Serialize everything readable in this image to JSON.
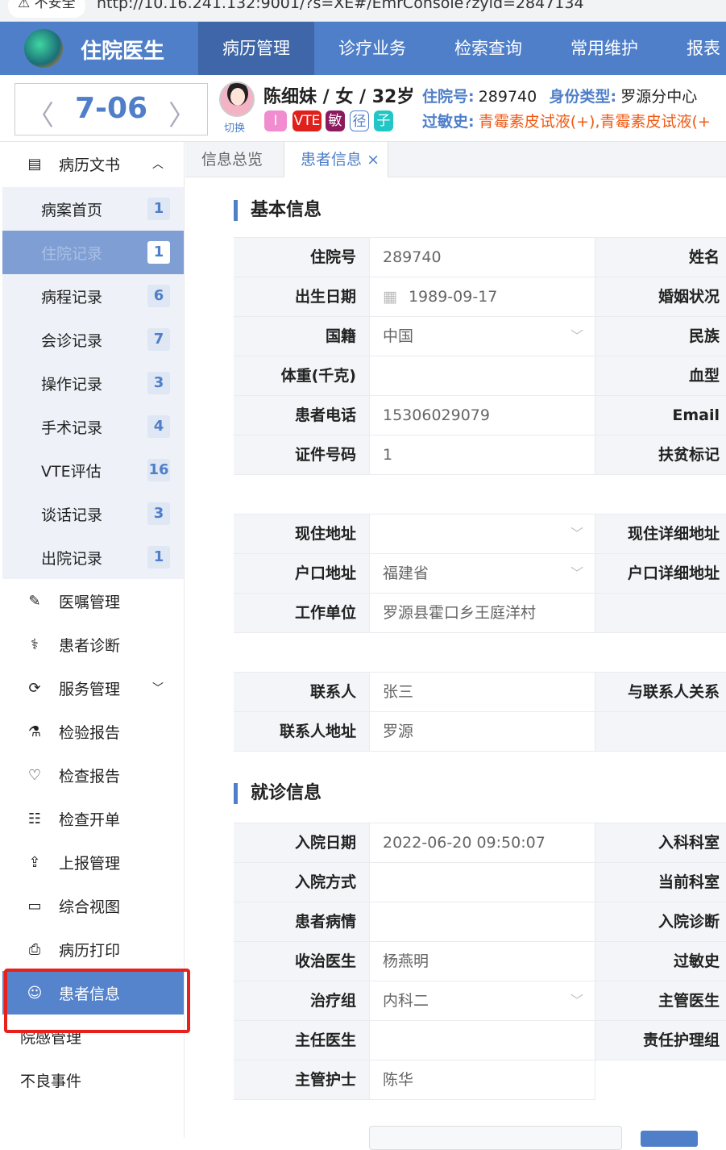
{
  "browser": {
    "security": "⚠ 不安全",
    "url": "http://10.16.241.132:9001/?s=XE#/EmrConsole?zyid=2847134"
  },
  "header": {
    "brand": "住院医生",
    "nav": [
      "病历管理",
      "诊疗业务",
      "检索查询",
      "常用维护",
      "报表"
    ]
  },
  "patient": {
    "date": "7-06",
    "switch": "切换",
    "name": "陈细妹 / 女 / 32岁",
    "tags": [
      {
        "t": "I",
        "c": "#f08ccf"
      },
      {
        "t": "VTE",
        "c": "#e0201a"
      },
      {
        "t": "敏",
        "c": "#8b1a5e"
      },
      {
        "t": "径",
        "c": "#fff"
      },
      {
        "t": "子",
        "c": "#22c6c6"
      }
    ],
    "admit_label": "住院号:",
    "admit_no": "289740",
    "type_label": "身份类型:",
    "type_value": "罗源分中心",
    "allergy_label": "过敏史:",
    "allergy_value": "青霉素皮试液(+),青霉素皮试液(+"
  },
  "sidebar": {
    "group": "病历文书",
    "sub": [
      {
        "l": "病案首页",
        "n": "1"
      },
      {
        "l": "住院记录",
        "n": "1"
      },
      {
        "l": "病程记录",
        "n": "6"
      },
      {
        "l": "会诊记录",
        "n": "7"
      },
      {
        "l": "操作记录",
        "n": "3"
      },
      {
        "l": "手术记录",
        "n": "4"
      },
      {
        "l": "VTE评估",
        "n": "16"
      },
      {
        "l": "谈话记录",
        "n": "3"
      },
      {
        "l": "出院记录",
        "n": "1"
      }
    ],
    "items": [
      {
        "l": "医嘱管理",
        "i": "✎"
      },
      {
        "l": "患者诊断",
        "i": "⚕"
      },
      {
        "l": "服务管理",
        "i": "⟳"
      },
      {
        "l": "检验报告",
        "i": "⚗"
      },
      {
        "l": "检查报告",
        "i": "♡"
      },
      {
        "l": "检查开单",
        "i": "☷"
      },
      {
        "l": "上报管理",
        "i": "⇪"
      },
      {
        "l": "综合视图",
        "i": "▭"
      },
      {
        "l": "病历打印",
        "i": "⎙"
      },
      {
        "l": "患者信息",
        "i": "☺"
      },
      {
        "l": "院感管理",
        "i": ""
      },
      {
        "l": "不良事件",
        "i": ""
      }
    ]
  },
  "tabs": [
    {
      "l": "信息总览"
    },
    {
      "l": "患者信息",
      "close": "×"
    }
  ],
  "basic": {
    "title": "基本信息",
    "rows": [
      [
        "住院号",
        "289740",
        "姓名"
      ],
      [
        "出生日期",
        "1989-09-17",
        "婚姻状况",
        "date"
      ],
      [
        "国籍",
        "中国",
        "民族",
        "select"
      ],
      [
        "体重(千克)",
        "",
        "血型"
      ],
      [
        "患者电话",
        "15306029079",
        "Email"
      ],
      [
        "证件号码",
        "1",
        "扶贫标记"
      ],
      null,
      [
        "现住地址",
        "",
        "现住详细地址",
        "select"
      ],
      [
        "户口地址",
        "福建省",
        "户口详细地址",
        "select"
      ],
      [
        "工作单位",
        "罗源县霍口乡王庭洋村",
        ""
      ],
      null,
      [
        "联系人",
        "张三",
        "与联系人关系"
      ],
      [
        "联系人地址",
        "罗源",
        ""
      ]
    ]
  },
  "visit": {
    "title": "就诊信息",
    "rows": [
      [
        "入院日期",
        "2022-06-20 09:50:07",
        "入科科室"
      ],
      [
        "入院方式",
        "",
        "当前科室"
      ],
      [
        "患者病情",
        "",
        "入院诊断"
      ],
      [
        "收治医生",
        "杨燕明",
        "过敏史"
      ],
      [
        "治疗组",
        "内科二",
        "主管医生",
        "select"
      ],
      [
        "主任医生",
        "",
        "责任护理组"
      ],
      [
        "主管护士",
        "陈华",
        null
      ]
    ]
  }
}
